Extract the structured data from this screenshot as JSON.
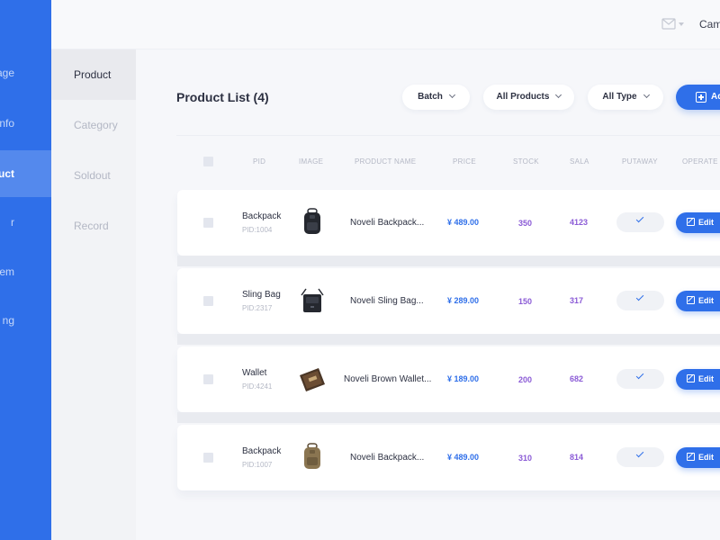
{
  "leftnav": {
    "items": [
      {
        "label": "age",
        "active": false
      },
      {
        "label": "nfo",
        "active": false
      },
      {
        "label": "duct",
        "active": true
      },
      {
        "label": "r",
        "active": false
      },
      {
        "label": "em",
        "active": false
      },
      {
        "label": "ng",
        "active": false
      }
    ]
  },
  "subnav": {
    "items": [
      {
        "label": "Product",
        "active": true
      },
      {
        "label": "Category",
        "active": false
      },
      {
        "label": "Soldout",
        "active": false
      },
      {
        "label": "Record",
        "active": false
      }
    ]
  },
  "header": {
    "user": "Cam",
    "mail_icon": "mail-icon"
  },
  "page": {
    "title": "Product List (4)"
  },
  "toolbar": {
    "batch": "Batch",
    "all_products": "All Products",
    "all_type": "All Type",
    "add": "Ad"
  },
  "table": {
    "headers": {
      "pid": "PID",
      "image": "IMAGE",
      "product_name": "PRODUCT NAME",
      "price": "PRICE",
      "stock": "STOCK",
      "sala": "SALA",
      "putaway": "PUTAWAY",
      "operate": "OPERATE"
    },
    "edit_label": "Edit",
    "rows": [
      {
        "name": "Backpack",
        "pid": "PID:1004",
        "product_name": "Noveli Backpack...",
        "price": "¥ 489.00",
        "stock": "350",
        "sala": "4123",
        "image": "black-backpack"
      },
      {
        "name": "Sling Bag",
        "pid": "PID:2317",
        "product_name": "Noveli Sling Bag...",
        "price": "¥ 289.00",
        "stock": "150",
        "sala": "317",
        "image": "black-sling-bag"
      },
      {
        "name": "Wallet",
        "pid": "PID:4241",
        "product_name": "Noveli Brown Wallet...",
        "price": "¥ 189.00",
        "stock": "200",
        "sala": "682",
        "image": "brown-wallet"
      },
      {
        "name": "Backpack",
        "pid": "PID:1007",
        "product_name": "Noveli Backpack...",
        "price": "¥ 489.00",
        "stock": "310",
        "sala": "814",
        "image": "khaki-backpack"
      }
    ]
  },
  "colors": {
    "primary": "#2f6fe9",
    "accent_purple": "#8b5bd6"
  }
}
